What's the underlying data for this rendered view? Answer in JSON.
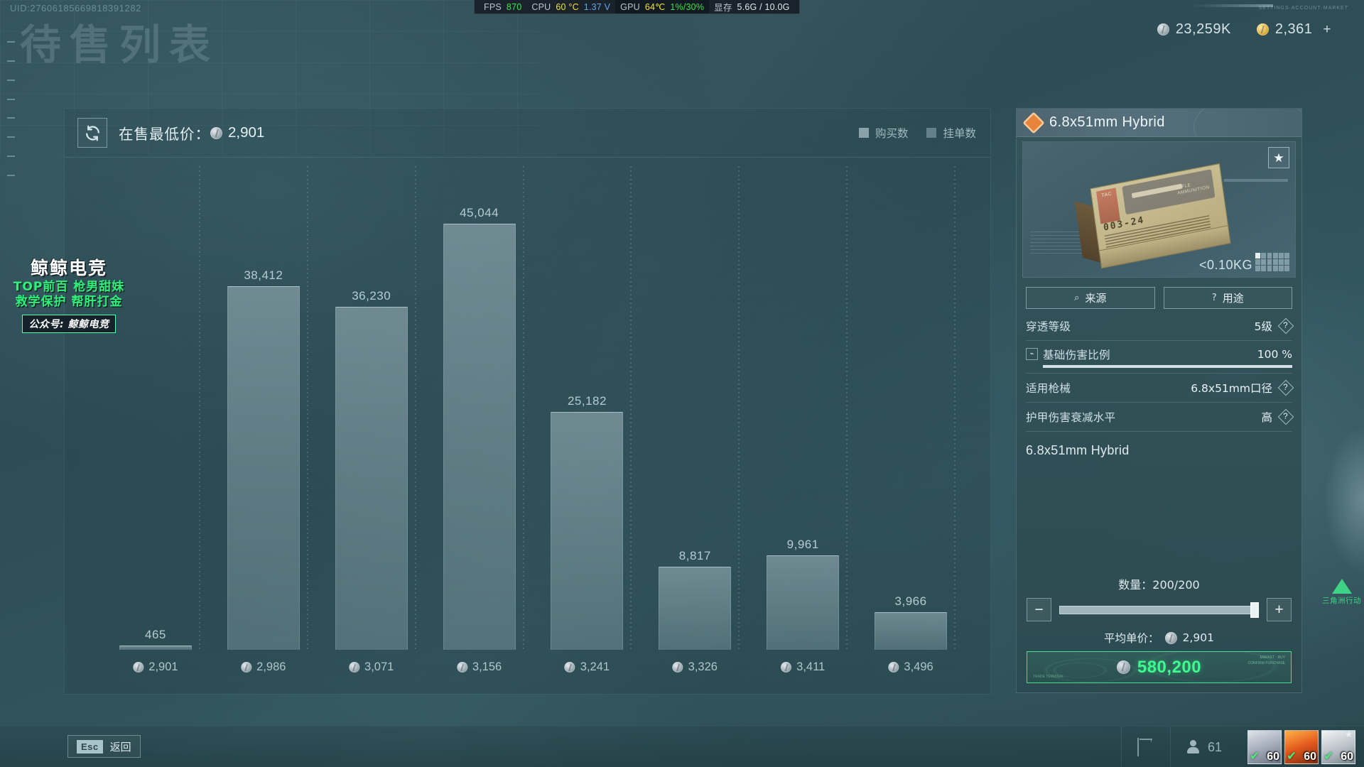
{
  "hud": {
    "uid": "UID:27606185669818391282",
    "page_title": "待售列表",
    "hw": {
      "fps_label": "FPS",
      "fps_value": "870",
      "cpu_label": "CPU",
      "cpu_temp": "60 °C",
      "cpu_volt": "1.37 V",
      "gpu_label": "GPU",
      "gpu_temp": "64℃",
      "gpu_load": "1%/30%",
      "vram_label": "显存",
      "vram_value": "5.6G / 10.0G"
    },
    "currency": {
      "silver": "23,259K",
      "gold": "2,361",
      "gold_plus": "+"
    }
  },
  "chart_panel": {
    "refresh_icon": "refresh-icon",
    "lowest_price_label": "在售最低价：",
    "lowest_price_value": "2,901",
    "legend": [
      {
        "label": "购买数"
      },
      {
        "label": "挂单数"
      }
    ]
  },
  "chart_data": {
    "type": "bar",
    "title": "在售最低价：2,901",
    "xlabel": "",
    "ylabel": "挂单数",
    "categories": [
      "2,901",
      "2,986",
      "3,071",
      "3,156",
      "3,241",
      "3,326",
      "3,411",
      "3,496"
    ],
    "values": [
      465,
      38412,
      36230,
      45044,
      25182,
      8817,
      9961,
      3966
    ],
    "series": [
      {
        "name": "挂单数",
        "values": [
          465,
          38412,
          36230,
          45044,
          25182,
          8817,
          9961,
          3966
        ]
      }
    ],
    "value_labels": [
      "465",
      "38,412",
      "36,230",
      "45,044",
      "25,182",
      "8,817",
      "9,961",
      "3,966"
    ],
    "ylim": [
      0,
      45044
    ],
    "grid": "dotted-vertical",
    "legend_position": "top-right"
  },
  "item": {
    "rarity_icon": "rarity-diamond-icon",
    "title": "6.8x51mm Hybrid",
    "favorite_icon": "star-icon",
    "weight": "<0.10KG",
    "box_brand": "TAC",
    "box_label": "RIFLE AMMUNITION",
    "box_code": "003-24",
    "buttons": [
      {
        "icon": "magnifier-icon",
        "label": "来源"
      },
      {
        "icon": "question-icon",
        "label": "用途"
      }
    ],
    "stats": [
      {
        "key": "穿透等级",
        "value": "5级",
        "help": "?"
      },
      {
        "key": "基础伤害比例",
        "value": "100 %",
        "help": "",
        "progress": 100,
        "icon": "damage-icon"
      },
      {
        "key": "适用枪械",
        "value": "6.8x51mm口径",
        "help": "?"
      },
      {
        "key": "护甲伤害衰减水平",
        "value": "高",
        "help": "?"
      }
    ],
    "description_title": "6.8x51mm Hybrid",
    "quantity_label": "数量：",
    "quantity_value": "200/200",
    "decrease_label": "−",
    "increase_label": "+",
    "slider_percent": 100,
    "avg_price_label": "平均单价：",
    "avg_price_value": "2,901",
    "buy_total": "580,200",
    "buy_accent": "#3dfb8e"
  },
  "watermark": {
    "title": "鲸鲸电竞",
    "line1": "TOP前百  枪男甜妹",
    "line2": "救学保护  帮肝打金",
    "tag": "公众号: 鲸鲸电竞"
  },
  "bottom": {
    "esc_key": "Esc",
    "esc_label": "返回",
    "flag_icon": "flag-icon",
    "friends_icon": "people-icon",
    "friends_count": "61",
    "avatars": [
      {
        "level": "60",
        "check": "✔"
      },
      {
        "level": "60",
        "check": "✔"
      },
      {
        "level": "60",
        "check": "✔"
      }
    ]
  },
  "side_logo": {
    "text": "三角洲行动"
  }
}
